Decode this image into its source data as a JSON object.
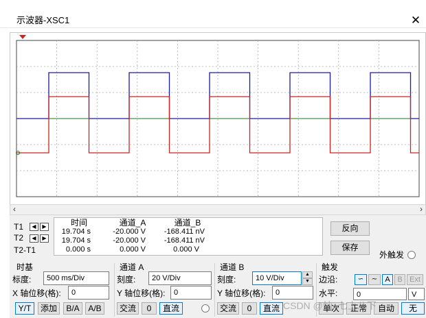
{
  "window": {
    "title": "示波器-XSC1",
    "close_glyph": "✕"
  },
  "colors": {
    "channel_a": "#cc2222",
    "channel_b": "#1a1aa8",
    "zero_line": "#1a7a1a",
    "grid": "#a8a8a8",
    "screen_bg": "#ffffff"
  },
  "scope": {
    "marker_t1": "T1 cursor (red triangle, top-left)",
    "marker_t2": "T2 cursor (green marker, left)"
  },
  "readout": {
    "row_labels": [
      "T1",
      "T2",
      "T2-T1"
    ],
    "headers": [
      "时间",
      "通道_A",
      "通道_B"
    ],
    "rows": [
      [
        "19.704 s",
        "-20.000 V",
        "-168.411 nV"
      ],
      [
        "19.704 s",
        "-20.000 V",
        "-168.411 nV"
      ],
      [
        "0.000 s",
        "0.000 V",
        "0.000 V"
      ]
    ]
  },
  "buttons": {
    "reverse": "反向",
    "save": "保存",
    "ext_trigger": "外触发"
  },
  "timebase": {
    "title": "时基",
    "scale_label": "标度:",
    "scale_value": "500 ms/Div",
    "xpos_label": "X 轴位移(格):",
    "xpos_value": "0",
    "modes": [
      "Y/T",
      "添加",
      "B/A",
      "A/B"
    ]
  },
  "channel_a": {
    "title": "通道 A",
    "scale_label": "刻度:",
    "scale_value": "20  V/Div",
    "ypos_label": "Y 轴位移(格):",
    "ypos_value": "0",
    "coupling": [
      "交流",
      "0",
      "直流"
    ]
  },
  "channel_b": {
    "title": "通道 B",
    "scale_label": "刻度:",
    "scale_value": "10  V/Div",
    "ypos_label": "Y 轴位移(格):",
    "ypos_value": "0",
    "coupling": [
      "交流",
      "0",
      "直流"
    ]
  },
  "trigger": {
    "title": "触发",
    "edge_label": "边沿:",
    "edge_buttons": [
      "A",
      "B",
      "Ext"
    ],
    "level_label": "水平:",
    "level_value": "0",
    "level_unit": "V",
    "modes": [
      "单次",
      "正常",
      "自动",
      "无"
    ]
  },
  "watermark": "CSDN @灿+七上八下"
}
